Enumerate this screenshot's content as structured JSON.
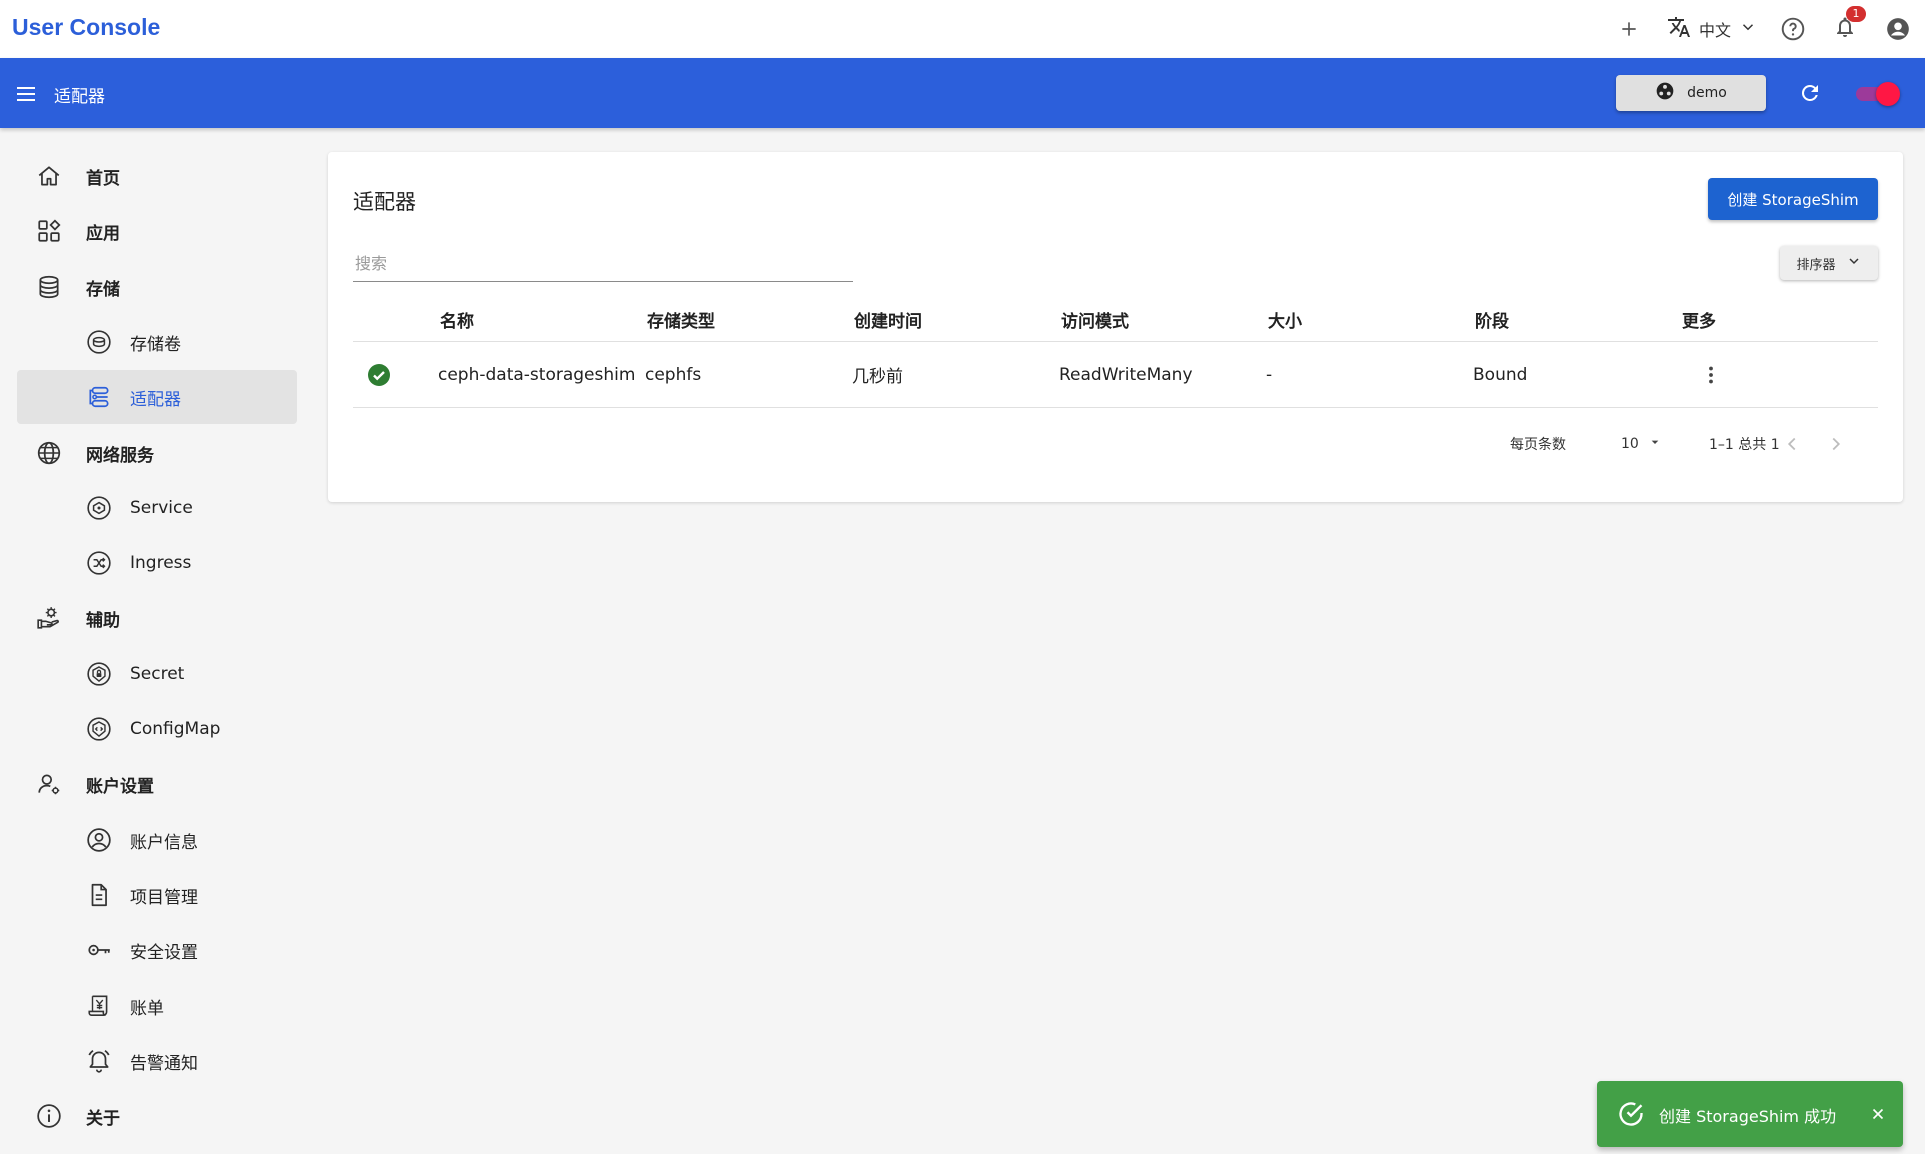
{
  "app": {
    "title": "User Console"
  },
  "topbar": {
    "language": "中文",
    "notifications_count": "1"
  },
  "header": {
    "page_title": "适配器",
    "namespace": "demo"
  },
  "sidebar": {
    "items": [
      {
        "label": "首页",
        "level": "top",
        "icon": "home-icon"
      },
      {
        "label": "应用",
        "level": "top",
        "icon": "apps-icon"
      },
      {
        "label": "存储",
        "level": "top",
        "icon": "database-icon"
      },
      {
        "label": "存储卷",
        "level": "sub",
        "icon": "volume-icon"
      },
      {
        "label": "适配器",
        "level": "sub",
        "icon": "adapter-icon",
        "active": true
      },
      {
        "label": "网络服务",
        "level": "top",
        "icon": "globe-icon"
      },
      {
        "label": "Service",
        "level": "sub",
        "icon": "service-icon"
      },
      {
        "label": "Ingress",
        "level": "sub",
        "icon": "ingress-icon"
      },
      {
        "label": "辅助",
        "level": "top",
        "icon": "hand-gear-icon"
      },
      {
        "label": "Secret",
        "level": "sub",
        "icon": "secret-icon"
      },
      {
        "label": "ConfigMap",
        "level": "sub",
        "icon": "configmap-icon"
      },
      {
        "label": "账户设置",
        "level": "top",
        "icon": "user-gear-icon"
      },
      {
        "label": "账户信息",
        "level": "sub",
        "icon": "account-circle-icon"
      },
      {
        "label": "项目管理",
        "level": "sub",
        "icon": "document-icon"
      },
      {
        "label": "安全设置",
        "level": "sub",
        "icon": "key-icon"
      },
      {
        "label": "账单",
        "level": "sub",
        "icon": "bill-icon"
      },
      {
        "label": "告警通知",
        "level": "sub",
        "icon": "alarm-bell-icon"
      },
      {
        "label": "关于",
        "level": "top",
        "icon": "info-icon"
      }
    ]
  },
  "main": {
    "title": "适配器",
    "create_button": "创建 StorageShim",
    "search_placeholder": "搜索",
    "sort_button": "排序器",
    "table": {
      "columns": [
        "名称",
        "存储类型",
        "创建时间",
        "访问模式",
        "大小",
        "阶段",
        "更多"
      ],
      "rows": [
        {
          "status": "ready",
          "name": "ceph-data-storageshim",
          "storage_type": "cephfs",
          "created": "几秒前",
          "access_mode": "ReadWriteMany",
          "size": "-",
          "phase": "Bound"
        }
      ]
    },
    "pagination": {
      "rows_per_page_label": "每页条数",
      "rows_per_page": "10",
      "range": "1–1 总共 1"
    }
  },
  "snackbar": {
    "message": "创建 StorageShim 成功"
  },
  "colors": {
    "brand": "#2c5fd9",
    "header_bar": "#2c5fdb",
    "primary_button": "#1d63d0",
    "success": "#43a047",
    "status_ok": "#2e7d32"
  }
}
